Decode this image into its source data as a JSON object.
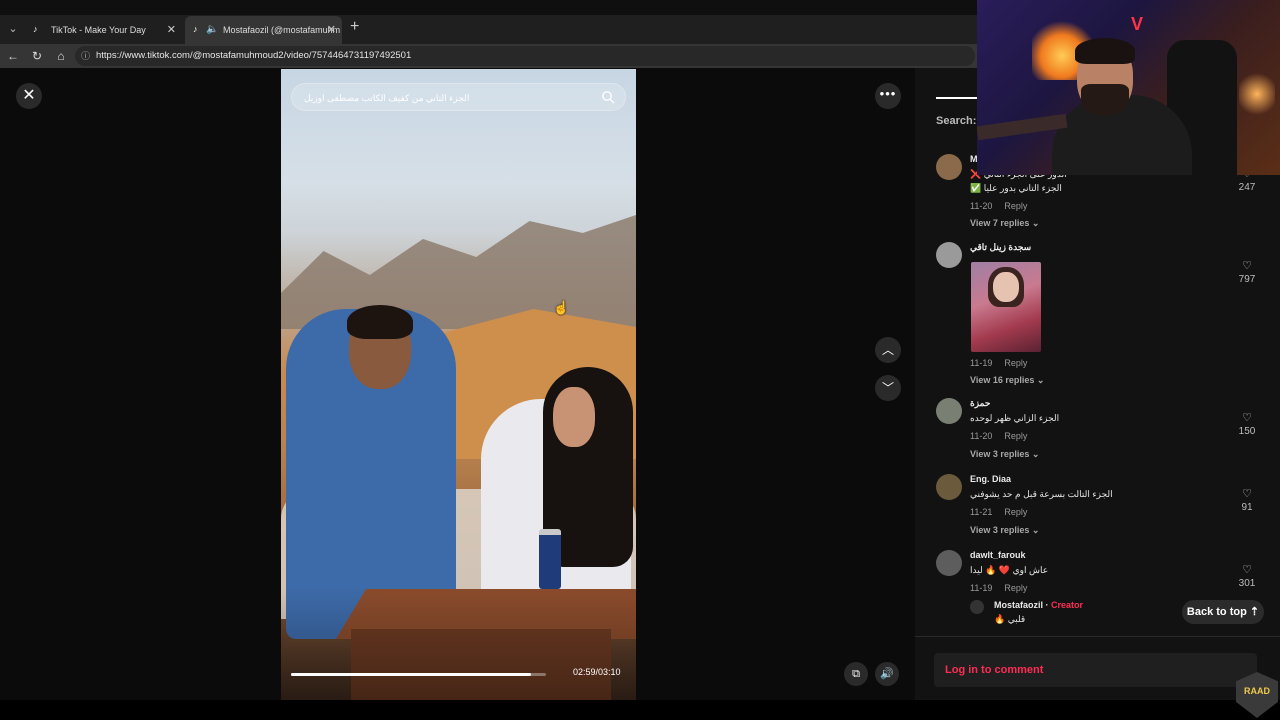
{
  "browser": {
    "tabs": [
      {
        "label": "TikTok - Make Your Day",
        "active": false
      },
      {
        "label": "Mostafaozil (@mostafamuhm",
        "active": true
      }
    ],
    "url": "https://www.tiktok.com/@mostafamuhmoud2/video/7574464731197492501"
  },
  "player": {
    "video_search_text": "الجزء التاني من كفيف الكاتب مصطفى اوزيل",
    "time": "02:59/03:10",
    "progress_fraction": 0.94
  },
  "panel": {
    "search_label": "Search: ",
    "comments": [
      {
        "user": "M",
        "lines": [
          "❌ الدور على الجزء التاني",
          "✅ الجزء التاني بدور عليا"
        ],
        "date": "11-20",
        "reply": "Reply",
        "likes": "247",
        "view_replies": "View 7 replies"
      },
      {
        "user": "سجدة زينل تاقي",
        "lines": [],
        "date": "11-19",
        "reply": "Reply",
        "likes": "797",
        "view_replies": "View 16 replies"
      },
      {
        "user": "حمزة",
        "lines": [
          "الجزء الزاني ظهر لوحده"
        ],
        "date": "11-20",
        "reply": "Reply",
        "likes": "150",
        "view_replies": "View 3 replies"
      },
      {
        "user": "Eng. Diaa",
        "lines": [
          "الجزء التالت بسرعة قبل م حد يشوفني"
        ],
        "date": "11-21",
        "reply": "Reply",
        "likes": "91",
        "view_replies": "View 3 replies"
      },
      {
        "user": "dawlt_farouk",
        "lines": [
          "عاش اوي ❤️ 🔥 ليدا"
        ],
        "date": "11-19",
        "reply": "Reply",
        "likes": "301",
        "view_replies": ""
      }
    ],
    "creator_reply": {
      "user": "Mostafaozil",
      "tag": "Creator",
      "text": "🔥 قلبي"
    },
    "back_to_top": "Back to top",
    "login_prompt": "Log in to comment"
  },
  "overlay": {
    "badge_text": "RAAD"
  }
}
